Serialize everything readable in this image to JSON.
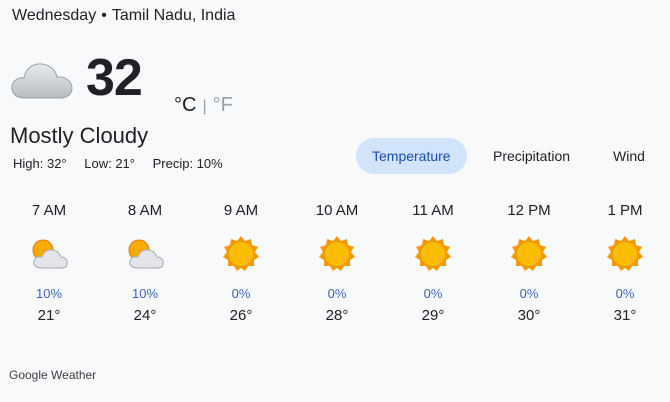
{
  "header": {
    "day": "Wednesday",
    "separator": "•",
    "location": "Tamil Nadu, India"
  },
  "current": {
    "icon": "mostly-cloudy-icon",
    "temperature": "32",
    "unit_c": "°C",
    "unit_divider": "|",
    "unit_f": "°F",
    "condition": "Mostly Cloudy",
    "high": "High: 32°",
    "low": "Low: 21°",
    "precip": "Precip: 10%"
  },
  "tabs": [
    {
      "label": "Temperature",
      "active": true
    },
    {
      "label": "Precipitation",
      "active": false
    },
    {
      "label": "Wind",
      "active": false
    }
  ],
  "hourly": [
    {
      "time": "7 AM",
      "icon": "partly-cloudy-icon",
      "precip": "10%",
      "temp": "21°"
    },
    {
      "time": "8 AM",
      "icon": "partly-cloudy-icon",
      "precip": "10%",
      "temp": "24°"
    },
    {
      "time": "9 AM",
      "icon": "sunny-icon",
      "precip": "0%",
      "temp": "26°"
    },
    {
      "time": "10 AM",
      "icon": "sunny-icon",
      "precip": "0%",
      "temp": "28°"
    },
    {
      "time": "11 AM",
      "icon": "sunny-icon",
      "precip": "0%",
      "temp": "29°"
    },
    {
      "time": "12 PM",
      "icon": "sunny-icon",
      "precip": "0%",
      "temp": "30°"
    },
    {
      "time": "1 PM",
      "icon": "sunny-icon",
      "precip": "0%",
      "temp": "31°"
    }
  ],
  "footer": {
    "source": "Google Weather"
  },
  "colors": {
    "active_tab_bg": "#d2e3fc",
    "precip_text": "#3c66b5",
    "sun": "#f9ab00"
  }
}
